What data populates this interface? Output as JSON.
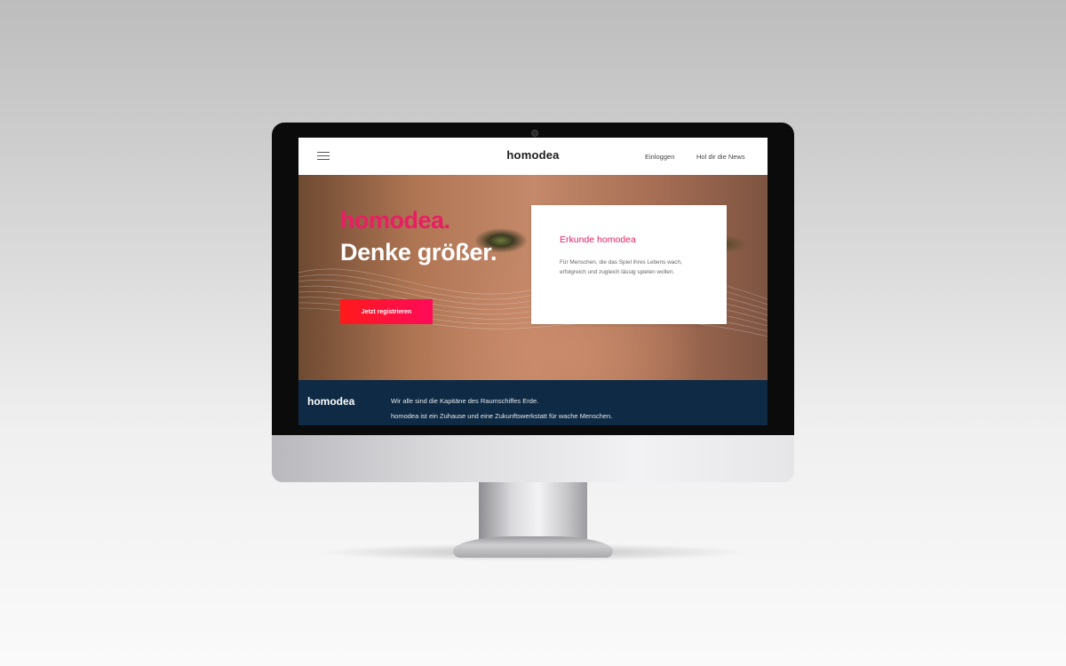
{
  "nav": {
    "brand": "homodea",
    "login_label": "Einloggen",
    "news_label": "Hol dir die News",
    "menu_icon": "hamburger-menu-icon"
  },
  "hero": {
    "logo_text": "homodea.",
    "slogan": "Denke größer.",
    "register_label": "Jetzt registrieren",
    "accent_color": "#e91e63",
    "button_color": "#ff1a3c"
  },
  "card": {
    "title": "Erkunde homodea",
    "text": "Für Menschen, die das Spiel ihres Lebens wach, erfolgreich und zugleich lässig spielen wollen."
  },
  "footer": {
    "logo": "homodea",
    "line1": "Wir alle sind die Kapitäne des Raumschiffes Erde.",
    "line2": "homodea ist ein Zuhause und eine Zukunftswerkstatt für wache Menschen.",
    "background_color": "#0e2a44"
  }
}
